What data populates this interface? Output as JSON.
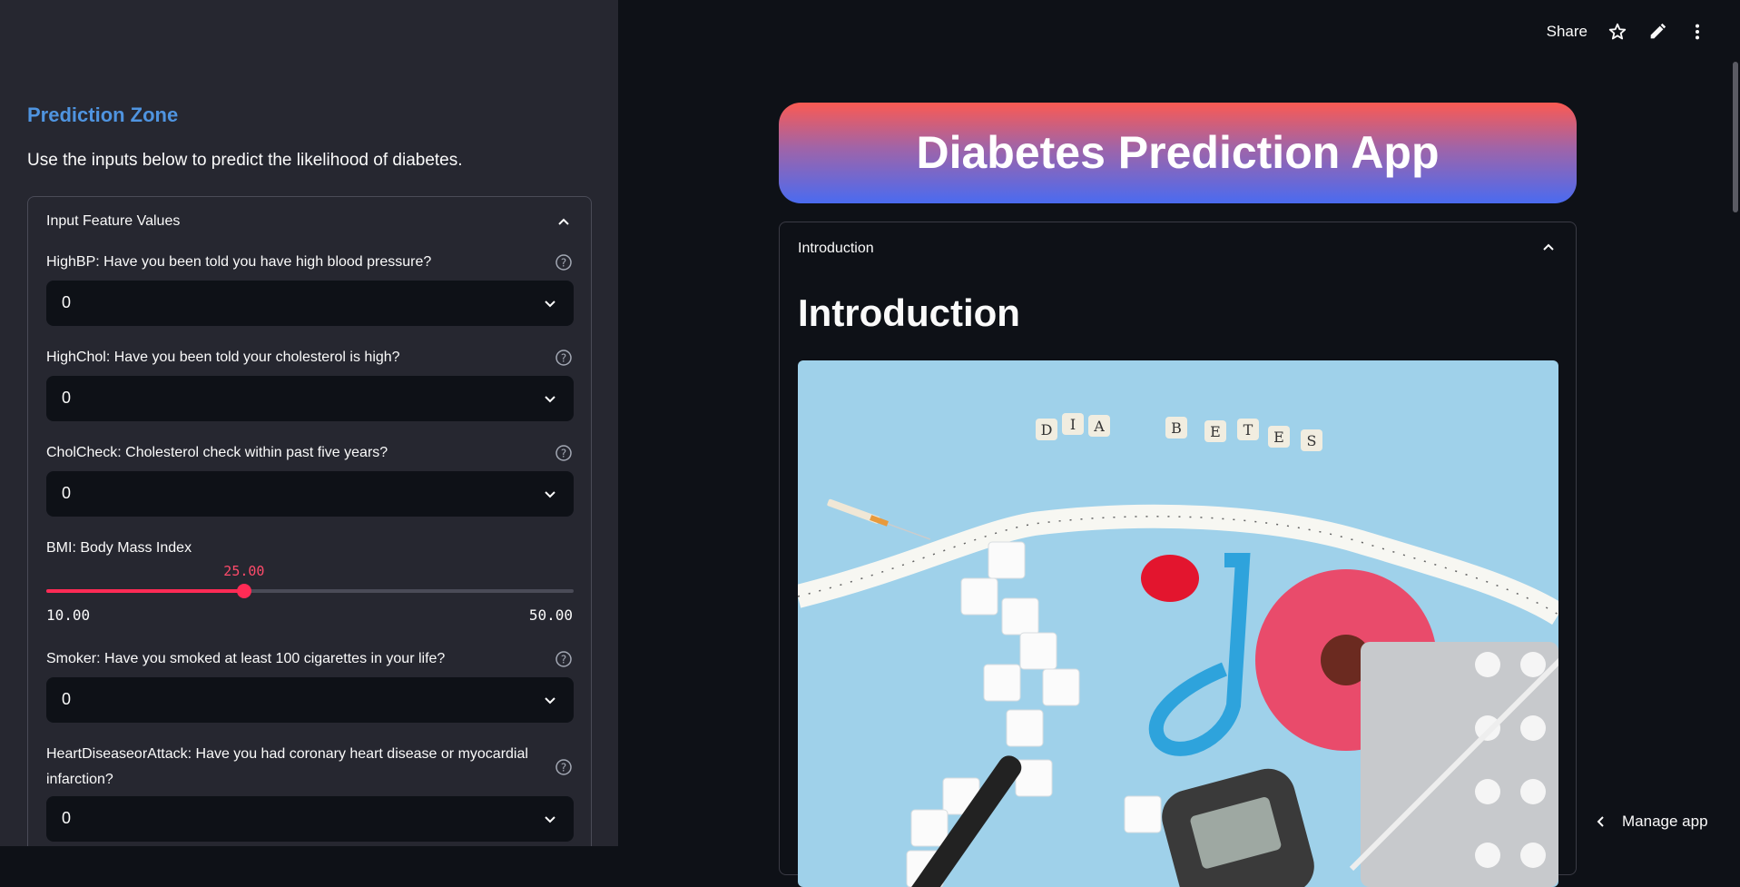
{
  "sidebar": {
    "title": "Prediction Zone",
    "description": "Use the inputs below to predict the likelihood of diabetes.",
    "expander_label": "Input Feature Values",
    "fields": [
      {
        "label": "HighBP: Have you been told you have high blood pressure?",
        "value": "0"
      },
      {
        "label": "HighChol: Have you been told your cholesterol is high?",
        "value": "0"
      },
      {
        "label": "CholCheck: Cholesterol check within past five years?",
        "value": "0"
      },
      {
        "label": "Smoker: Have you smoked at least 100 cigarettes in your life?",
        "value": "0"
      },
      {
        "label": "HeartDiseaseorAttack: Have you had coronary heart disease or myocardial infarction?",
        "value": "0"
      }
    ],
    "bmi": {
      "label": "BMI: Body Mass Index",
      "value": "25.00",
      "min": "10.00",
      "max": "50.00",
      "fraction": 0.375
    }
  },
  "toolbar": {
    "share_label": "Share"
  },
  "main": {
    "banner_title": "Diabetes Prediction App",
    "expander_label": "Introduction",
    "intro_heading": "Introduction",
    "image_letters": [
      "D",
      "I",
      "A",
      "B",
      "E",
      "T",
      "E",
      "S"
    ]
  },
  "manage_label": "Manage app",
  "colors": {
    "accent": "#ff2b55",
    "sidebar_title": "#4f94e0",
    "sidebar_bg": "#262730",
    "main_bg": "#0e1117"
  }
}
